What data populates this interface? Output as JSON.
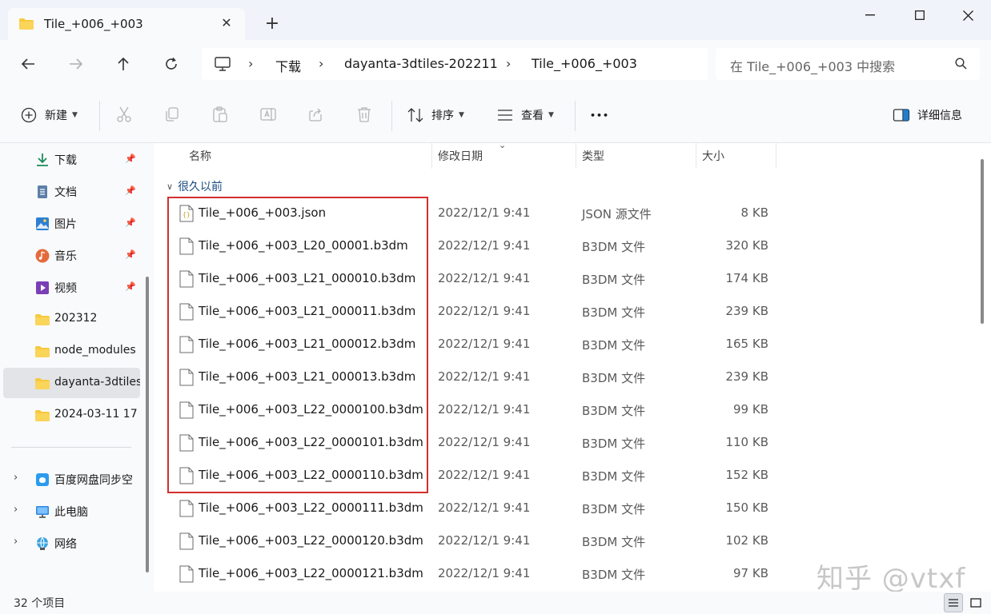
{
  "window": {
    "tab_title": "Tile_+006_+003",
    "close_glyph": "✕",
    "new_tab_glyph": "+"
  },
  "address": {
    "crumbs": [
      "下载",
      "dayanta-3dtiles-202211",
      "Tile_+006_+003"
    ],
    "separator": "›",
    "search_placeholder": "在 Tile_+006_+003 中搜索"
  },
  "toolbar": {
    "new_label": "新建",
    "sort_label": "排序",
    "view_label": "查看",
    "more_label": "•••",
    "details_label": "详细信息"
  },
  "sidebar": {
    "items": [
      {
        "label": "下载",
        "icon": "download-icon",
        "pinned": true
      },
      {
        "label": "文档",
        "icon": "document-icon",
        "pinned": true
      },
      {
        "label": "图片",
        "icon": "pictures-icon",
        "pinned": true
      },
      {
        "label": "音乐",
        "icon": "music-icon",
        "pinned": true
      },
      {
        "label": "视频",
        "icon": "video-icon",
        "pinned": true
      },
      {
        "label": "202312",
        "icon": "folder-icon",
        "pinned": false
      },
      {
        "label": "node_modules",
        "icon": "folder-icon",
        "pinned": false
      },
      {
        "label": "dayanta-3dtiles",
        "icon": "folder-icon",
        "pinned": false,
        "selected": true
      },
      {
        "label": "2024-03-11 17",
        "icon": "folder-icon",
        "pinned": false
      }
    ],
    "tree": [
      {
        "label": "百度网盘同步空",
        "icon": "baidu-netdisk-icon"
      },
      {
        "label": "此电脑",
        "icon": "computer-icon"
      },
      {
        "label": "网络",
        "icon": "network-icon"
      }
    ]
  },
  "columns": {
    "name": "名称",
    "date": "修改日期",
    "type": "类型",
    "size": "大小"
  },
  "group_label": "很久以前",
  "files": [
    {
      "name": "Tile_+006_+003.json",
      "date": "2022/12/1 9:41",
      "type": "JSON 源文件",
      "size": "8 KB",
      "icon": "json-file-icon"
    },
    {
      "name": "Tile_+006_+003_L20_00001.b3dm",
      "date": "2022/12/1 9:41",
      "type": "B3DM 文件",
      "size": "320 KB",
      "icon": "file-icon"
    },
    {
      "name": "Tile_+006_+003_L21_000010.b3dm",
      "date": "2022/12/1 9:41",
      "type": "B3DM 文件",
      "size": "174 KB",
      "icon": "file-icon"
    },
    {
      "name": "Tile_+006_+003_L21_000011.b3dm",
      "date": "2022/12/1 9:41",
      "type": "B3DM 文件",
      "size": "239 KB",
      "icon": "file-icon"
    },
    {
      "name": "Tile_+006_+003_L21_000012.b3dm",
      "date": "2022/12/1 9:41",
      "type": "B3DM 文件",
      "size": "165 KB",
      "icon": "file-icon"
    },
    {
      "name": "Tile_+006_+003_L21_000013.b3dm",
      "date": "2022/12/1 9:41",
      "type": "B3DM 文件",
      "size": "239 KB",
      "icon": "file-icon"
    },
    {
      "name": "Tile_+006_+003_L22_0000100.b3dm",
      "date": "2022/12/1 9:41",
      "type": "B3DM 文件",
      "size": "99 KB",
      "icon": "file-icon"
    },
    {
      "name": "Tile_+006_+003_L22_0000101.b3dm",
      "date": "2022/12/1 9:41",
      "type": "B3DM 文件",
      "size": "110 KB",
      "icon": "file-icon"
    },
    {
      "name": "Tile_+006_+003_L22_0000110.b3dm",
      "date": "2022/12/1 9:41",
      "type": "B3DM 文件",
      "size": "152 KB",
      "icon": "file-icon"
    },
    {
      "name": "Tile_+006_+003_L22_0000111.b3dm",
      "date": "2022/12/1 9:41",
      "type": "B3DM 文件",
      "size": "150 KB",
      "icon": "file-icon"
    },
    {
      "name": "Tile_+006_+003_L22_0000120.b3dm",
      "date": "2022/12/1 9:41",
      "type": "B3DM 文件",
      "size": "102 KB",
      "icon": "file-icon"
    },
    {
      "name": "Tile_+006_+003_L22_0000121.b3dm",
      "date": "2022/12/1 9:41",
      "type": "B3DM 文件",
      "size": "97 KB",
      "icon": "file-icon"
    }
  ],
  "status": {
    "item_count": "32 个项目"
  },
  "watermark": "知乎 @vtxf",
  "colors": {
    "highlight_border": "#d32f2f",
    "chrome_bg": "#f9fafc",
    "titlebar_bg": "#f0f3f9",
    "folder_yellow": "#f8c93c",
    "accent_blue": "#0067c0"
  }
}
